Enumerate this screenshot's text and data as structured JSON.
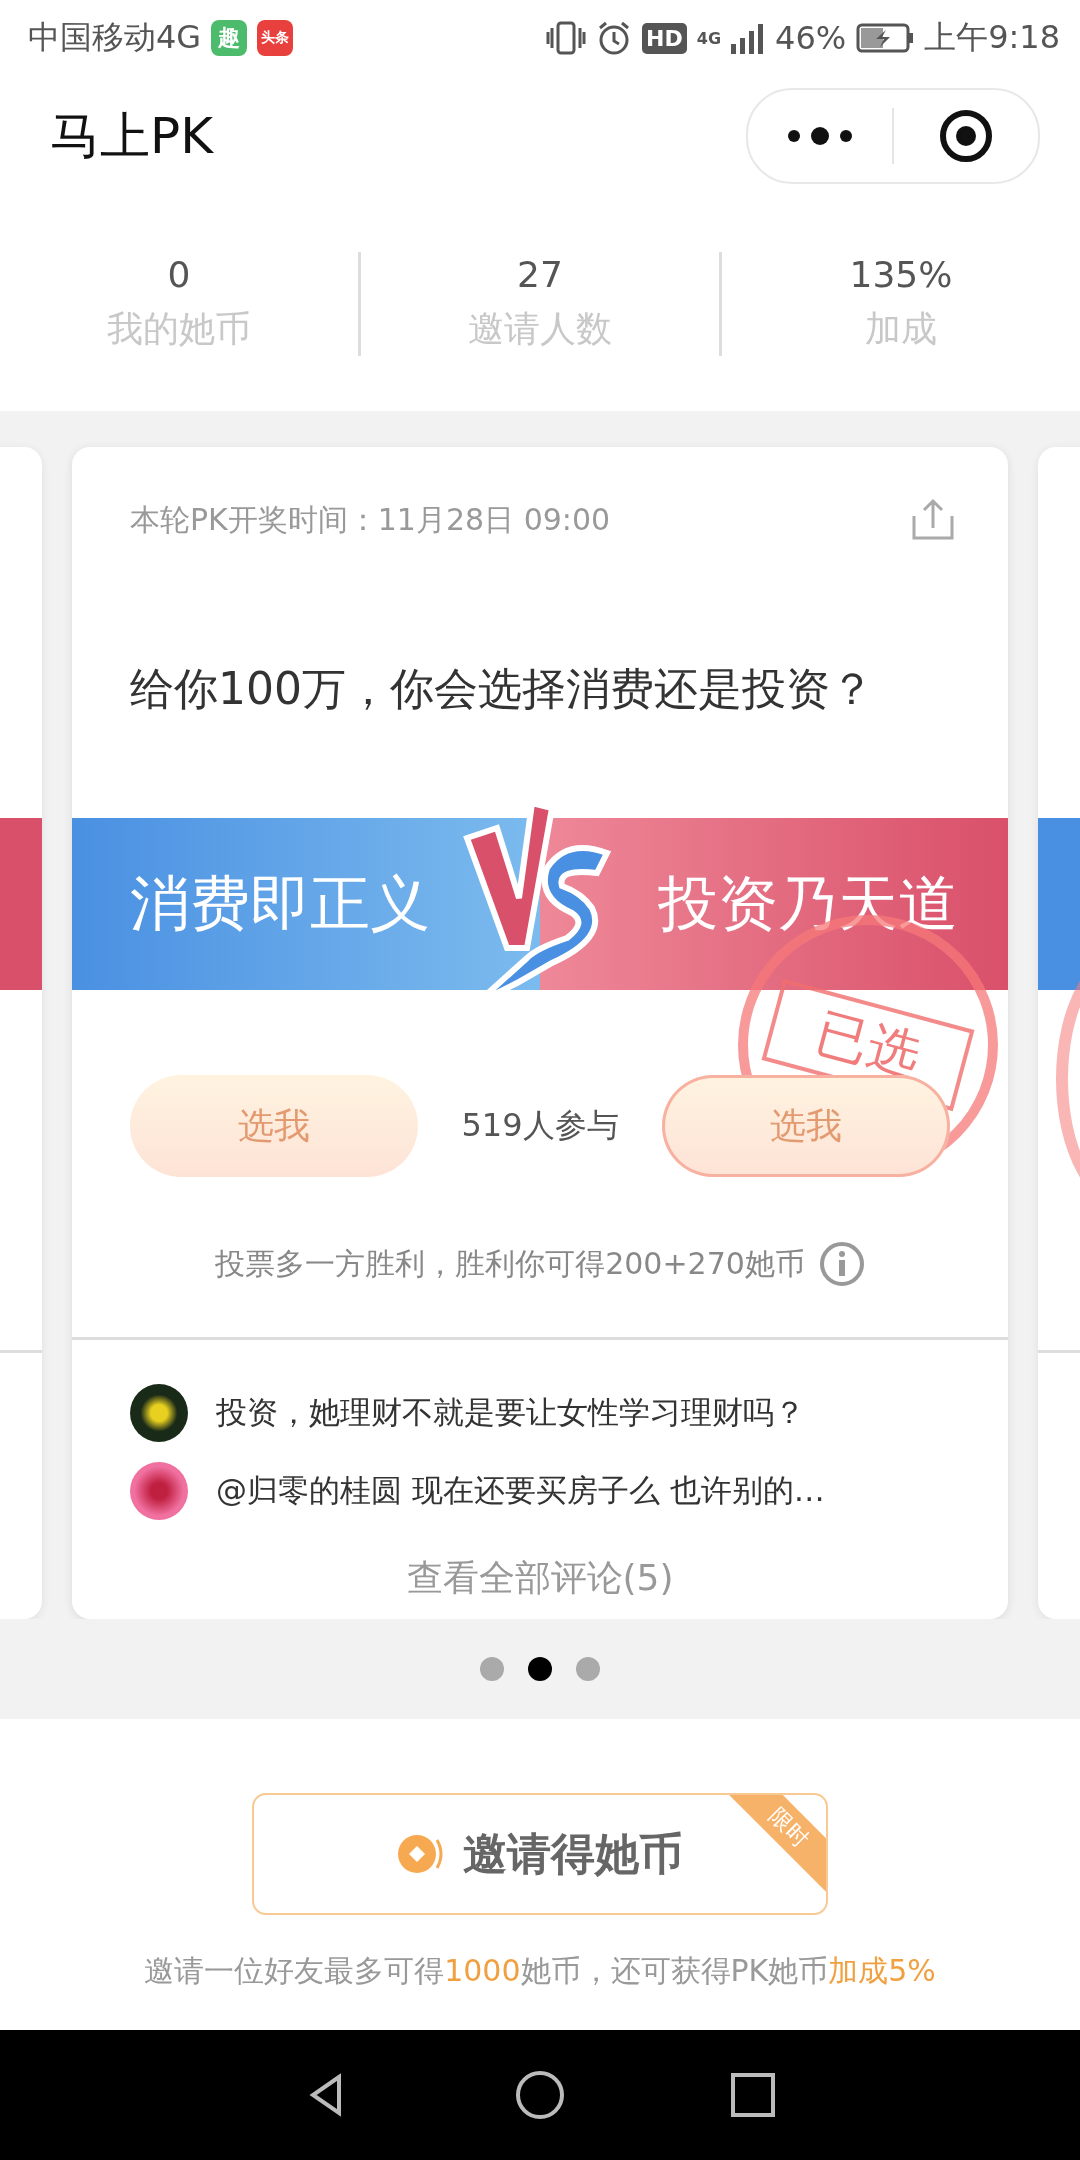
{
  "status_bar": {
    "carrier": "中国移动4G",
    "app_badges": [
      "趣",
      "头条"
    ],
    "hd": "HD",
    "network": "4G",
    "battery": "46%",
    "time": "上午9:18"
  },
  "header": {
    "title": "马上PK"
  },
  "stats": [
    {
      "value": "0",
      "label": "我的她币"
    },
    {
      "value": "27",
      "label": "邀请人数"
    },
    {
      "value": "135%",
      "label": "加成"
    }
  ],
  "card": {
    "draw_time": "本轮PK开奖时间：11月28日 09:00",
    "question": "给你100万，你会选择消费还是投资？",
    "options": [
      {
        "kind": "left",
        "title": "消费即正义",
        "button": "选我",
        "selected": false
      },
      {
        "kind": "right",
        "title": "投资乃天道",
        "button": "选我",
        "selected": true
      }
    ],
    "stamp": "已选",
    "participants": "519人参与",
    "rule": "投票多一方胜利，胜利你可得200+270她币",
    "comments": [
      {
        "kind": "flower",
        "text": "投资，她理财不就是要让女性学习理财吗？"
      },
      {
        "kind": "pink",
        "text": "@归零的桂圆 现在还要买房子么 也许别的…"
      }
    ],
    "view_all": "查看全部评论(5)"
  },
  "carousel_dots": [
    {
      "selected": false
    },
    {
      "selected": true
    },
    {
      "selected": false
    }
  ],
  "invite": {
    "button": "邀请得她币",
    "ribbon": "限时",
    "caption": [
      {
        "text": "邀请一位好友最多可得",
        "highlight": false
      },
      {
        "text": "1000",
        "highlight": true
      },
      {
        "text": "她币，还可获得PK她币",
        "highlight": false
      },
      {
        "text": "加成5%",
        "highlight": true
      }
    ]
  }
}
